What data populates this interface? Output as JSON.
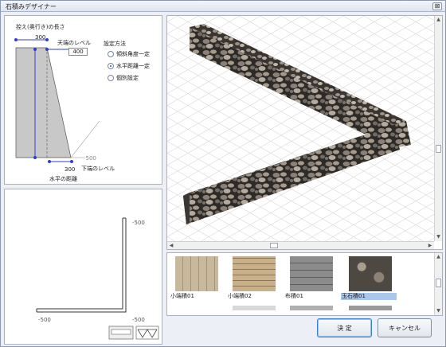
{
  "window": {
    "title": "石積みデザイナー",
    "close_glyph": "⊠"
  },
  "section": {
    "depth_label": "控え(奥行き)の長さ",
    "depth_value": "300",
    "top_level_label": "天端のレベル",
    "top_level_value": "400",
    "height_label": "高さ",
    "height_value": "900",
    "bottom_value": "-500",
    "horizontal_value": "300",
    "bottom_level_label": "下端のレベル",
    "horizontal_distance_label": "水平の距離"
  },
  "settings": {
    "title": "設定方法",
    "options": [
      {
        "label": "傾斜角度一定",
        "selected": false
      },
      {
        "label": "水平距離一定",
        "selected": true
      },
      {
        "label": "個別設定",
        "selected": false
      }
    ]
  },
  "plan": {
    "top_right": "-500",
    "bottom_right": "-500",
    "bottom_left": "-500"
  },
  "textures": [
    {
      "label": "小端積01",
      "selected": false,
      "color": "#c7b597"
    },
    {
      "label": "小端積02",
      "selected": false,
      "color": "#b9a27c"
    },
    {
      "label": "布積01",
      "selected": false,
      "color": "#7a7a7a"
    },
    {
      "label": "玉石積01",
      "selected": true,
      "color": "#6f675c"
    }
  ],
  "buttons": {
    "ok": "決 定",
    "cancel": "キャンセル"
  },
  "colors": {
    "accent": "#2f3fd0",
    "wall_dark": "#4a4540",
    "selection": "#aac8ee"
  }
}
